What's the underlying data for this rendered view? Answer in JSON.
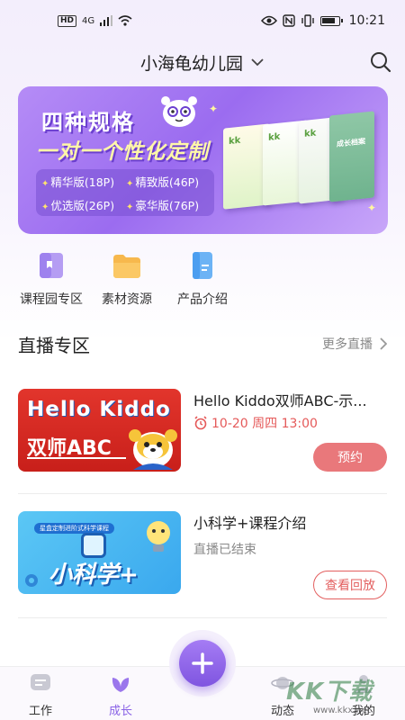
{
  "status_bar": {
    "hd": "HD",
    "network": "4G",
    "time": "10:21"
  },
  "header": {
    "school_name": "小海龟幼儿园",
    "dropdown_icon": "chevron-down-icon",
    "search_icon": "search-icon"
  },
  "banner": {
    "title_line1": "四种规格",
    "title_line2": "一对一个性化定制",
    "editions": [
      "精华版(18P)",
      "精致版(46P)",
      "优选版(26P)",
      "豪华版(76P)"
    ],
    "book_label": "成长档案"
  },
  "quick_links": [
    {
      "label": "课程园专区",
      "icon": "book-icon",
      "color": "#a98cf0"
    },
    {
      "label": "素材资源",
      "icon": "folder-icon",
      "color": "#f5b24a"
    },
    {
      "label": "产品介绍",
      "icon": "document-icon",
      "color": "#5aa9f2"
    }
  ],
  "live_section": {
    "title": "直播专区",
    "more": "更多直播"
  },
  "live_items": [
    {
      "title": "Hello Kiddo双师ABC-示...",
      "time": "10-20 周四 13:00",
      "button": "预约",
      "thumb_title": "Hello Kiddo",
      "thumb_subtitle": "双师ABC"
    },
    {
      "title": "小科学+课程介绍",
      "status": "直播已结束",
      "button": "查看回放",
      "thumb_title": "小科学+",
      "thumb_badge": "星盒定制进阶式科学课程"
    }
  ],
  "tabbar": {
    "tabs": [
      {
        "label": "工作",
        "icon": "chat-icon"
      },
      {
        "label": "成长",
        "icon": "leaf-icon",
        "active": true
      },
      {
        "label": "动态",
        "icon": "planet-icon"
      },
      {
        "label": "我的",
        "icon": "user-icon"
      }
    ],
    "fab_icon": "plus-icon"
  },
  "watermark": {
    "text": "KK下载",
    "url": "www.kkx.net"
  },
  "colors": {
    "accent": "#8a63e6",
    "reserve_button": "#e9787b",
    "replay_border": "#e35f5f",
    "time_red": "#e55a5a"
  }
}
